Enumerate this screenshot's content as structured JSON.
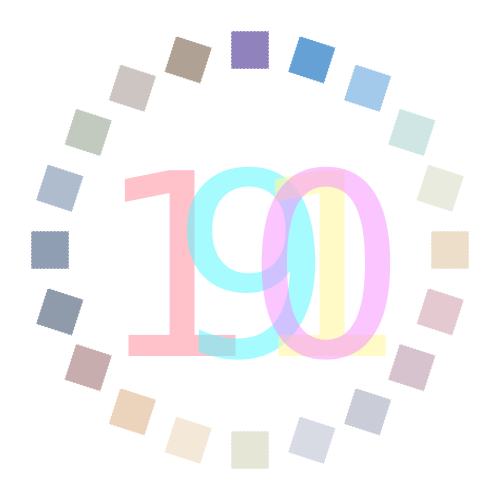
{
  "digits": [
    {
      "char": "1",
      "color": "#ff9aa8",
      "opacity": 0.6
    },
    {
      "char": "9",
      "color": "#5cf8ff",
      "opacity": 0.55
    },
    {
      "char": "1",
      "color": "#fff6a0",
      "opacity": 0.6
    },
    {
      "char": "0",
      "color": "#f88cff",
      "opacity": 0.5
    }
  ],
  "ring": {
    "tiles": [
      {
        "color": "#7c6cb0",
        "opacity": 0.85
      },
      {
        "color": "#4a90cc",
        "opacity": 0.85
      },
      {
        "color": "#84b8e4",
        "opacity": 0.75
      },
      {
        "color": "#bcdcd8",
        "opacity": 0.7
      },
      {
        "color": "#e0e2d0",
        "opacity": 0.7
      },
      {
        "color": "#e6d0b4",
        "opacity": 0.7
      },
      {
        "color": "#d8b4bc",
        "opacity": 0.7
      },
      {
        "color": "#c4aab8",
        "opacity": 0.7
      },
      {
        "color": "#b4b8c8",
        "opacity": 0.7
      },
      {
        "color": "#c8cad8",
        "opacity": 0.7
      },
      {
        "color": "#dcdcc4",
        "opacity": 0.7
      },
      {
        "color": "#f0e0c8",
        "opacity": 0.7
      },
      {
        "color": "#e2c0a0",
        "opacity": 0.7
      },
      {
        "color": "#b08a8c",
        "opacity": 0.7
      },
      {
        "color": "#6a788e",
        "opacity": 0.75
      },
      {
        "color": "#6a7e9a",
        "opacity": 0.75
      },
      {
        "color": "#8ca0b8",
        "opacity": 0.7
      },
      {
        "color": "#a8b4a4",
        "opacity": 0.7
      },
      {
        "color": "#b8aca8",
        "opacity": 0.7
      },
      {
        "color": "#948270",
        "opacity": 0.75
      }
    ]
  }
}
